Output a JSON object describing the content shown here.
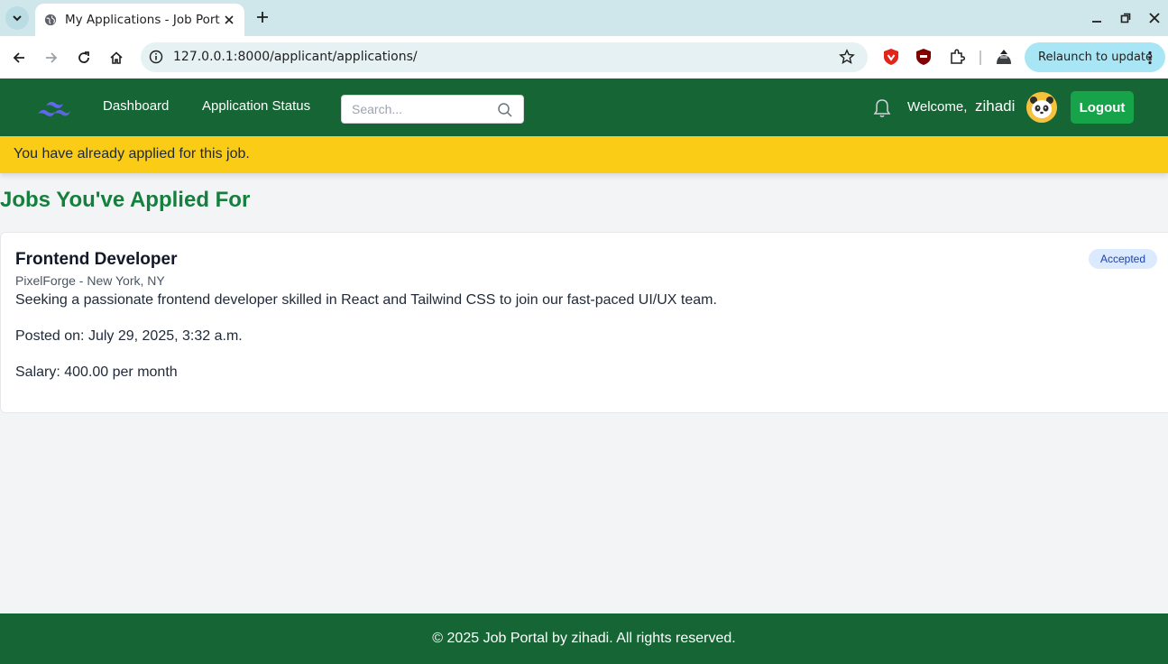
{
  "browser": {
    "tab_title": "My Applications - Job Portal",
    "url": "127.0.0.1:8000/applicant/applications/",
    "relaunch_label": "Relaunch to update"
  },
  "nav": {
    "links": [
      "Dashboard",
      "Application Status"
    ],
    "search_placeholder": "Search...",
    "welcome_label": "Welcome,",
    "username": "zihadi",
    "logout_label": "Logout"
  },
  "alert": {
    "message": "You have already applied for this job."
  },
  "page": {
    "heading": "Jobs You've Applied For"
  },
  "applications": [
    {
      "title": "Frontend Developer",
      "company_location": "PixelForge - New York, NY",
      "description": "Seeking a passionate frontend developer skilled in React and Tailwind CSS to join our fast-paced UI/UX team.",
      "posted": "Posted on: July 29, 2025, 3:32 a.m.",
      "salary": "Salary: 400.00 per month",
      "status": "Accepted"
    }
  ],
  "footer": {
    "text": "© 2025 Job Portal by zihadi. All rights reserved."
  },
  "colors": {
    "nav_bg": "#166534",
    "alert_bg": "#facc15",
    "heading": "#15803d",
    "logout_bg": "#16a34a",
    "badge_bg": "#dbeafe",
    "badge_text": "#1e40af"
  }
}
